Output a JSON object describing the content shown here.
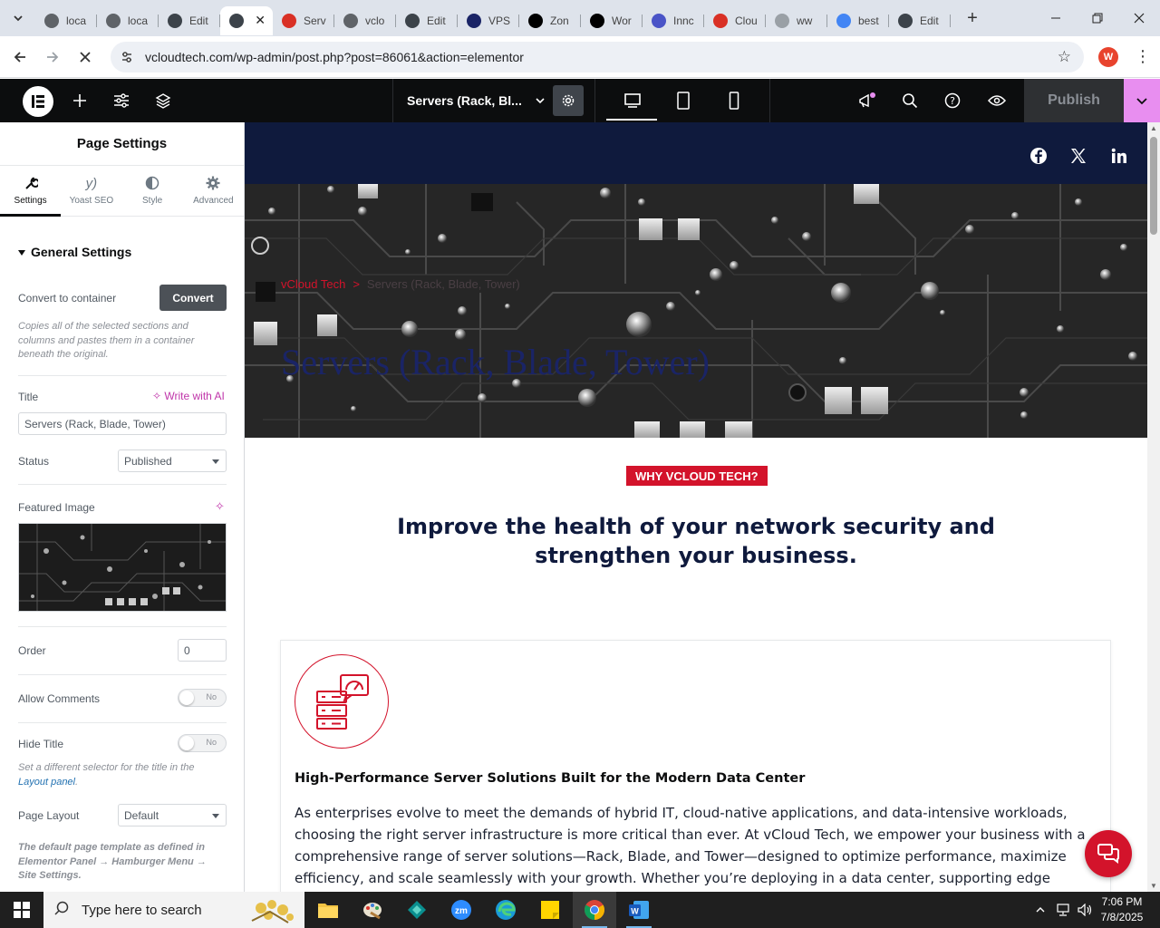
{
  "browser": {
    "tabs": [
      {
        "label": "loca",
        "icon": "mail-icon",
        "color": "#5f6368"
      },
      {
        "label": "loca",
        "icon": "mail-icon",
        "color": "#5f6368"
      },
      {
        "label": "Edit",
        "icon": "wordpress-icon",
        "color": "#3c434a"
      },
      {
        "label": "",
        "icon": "elementor-icon",
        "color": "#3c434a",
        "active": true
      },
      {
        "label": "Serv",
        "icon": "red-diamond-icon",
        "color": "#d93025"
      },
      {
        "label": "vclo",
        "icon": "globe-icon",
        "color": "#5f6368"
      },
      {
        "label": "Edit",
        "icon": "wordpress-icon",
        "color": "#3c434a"
      },
      {
        "label": "VPS",
        "icon": "v-icon",
        "color": "#1a2466"
      },
      {
        "label": "Zon",
        "icon": "z-icon",
        "color": "#000000"
      },
      {
        "label": "Wor",
        "icon": "openai-icon",
        "color": "#000000"
      },
      {
        "label": "Innc",
        "icon": "innocode-icon",
        "color": "#4a54c7"
      },
      {
        "label": "Clou",
        "icon": "cloud-icon",
        "color": "#d93025"
      },
      {
        "label": "ww",
        "icon": "circle-icon",
        "color": "#9aa0a6"
      },
      {
        "label": "best",
        "icon": "google-icon",
        "color": "#4285f4"
      },
      {
        "label": "Edit",
        "icon": "wordpress-icon",
        "color": "#3c434a"
      }
    ],
    "url": "vcloudtech.com/wp-admin/post.php?post=86061&action=elementor",
    "profile_initial": "W"
  },
  "elementor": {
    "doc_title": "Servers (Rack, Bl...",
    "publish_label": "Publish"
  },
  "panel": {
    "title": "Page Settings",
    "tabs": [
      {
        "label": "Settings",
        "icon": "wrench-icon"
      },
      {
        "label": "Yoast SEO",
        "icon": "yoast-icon"
      },
      {
        "label": "Style",
        "icon": "half-circle-icon"
      },
      {
        "label": "Advanced",
        "icon": "gear-icon"
      }
    ],
    "section": "General Settings",
    "convert_label": "Convert to container",
    "convert_button": "Convert",
    "convert_desc": "Copies all of the selected sections and columns and pastes them in a container beneath the original.",
    "title_label": "Title",
    "write_ai": "Write with AI",
    "title_value": "Servers (Rack, Blade, Tower)",
    "status_label": "Status",
    "status_value": "Published",
    "featured_label": "Featured Image",
    "order_label": "Order",
    "order_value": "0",
    "comments_label": "Allow Comments",
    "comments_value": "No",
    "hide_title_label": "Hide Title",
    "hide_title_value": "No",
    "hide_title_desc": "Set a different selector for the title in the",
    "hide_title_link": "Layout panel",
    "layout_label": "Page Layout",
    "layout_value": "Default",
    "layout_desc": "The default page template as defined in Elementor Panel → Hamburger Menu → Site Settings."
  },
  "page": {
    "social": [
      "facebook-icon",
      "x-icon",
      "linkedin-icon"
    ],
    "breadcrumb_home": "vCloud Tech",
    "breadcrumb_sep": ">",
    "breadcrumb_current": "Servers (Rack, Blade, Tower)",
    "hero_title": "Servers (Rack, Blade, Tower)",
    "badge": "WHY VCLOUD TECH?",
    "headline": "Improve the health of your network security and strengthen your business.",
    "card_title": "High-Performance Server Solutions Built for the Modern Data Center",
    "card_body": "As enterprises evolve to meet the demands of hybrid IT, cloud-native applications, and data-intensive workloads, choosing the right server infrastructure is more critical than ever. At vCloud Tech, we empower your business with a comprehensive range of server solutions—Rack, Blade, and Tower—designed to optimize performance, maximize efficiency, and scale seamlessly with your growth. Whether you’re deploying in a data center, supporting edge"
  },
  "taskbar": {
    "search_placeholder": "Type here to search",
    "time": "7:06 PM",
    "date": "7/8/2025"
  },
  "colors": {
    "accent_red": "#d3132b",
    "navy": "#0f1a3d",
    "elementor_pink": "#e88ef0"
  }
}
